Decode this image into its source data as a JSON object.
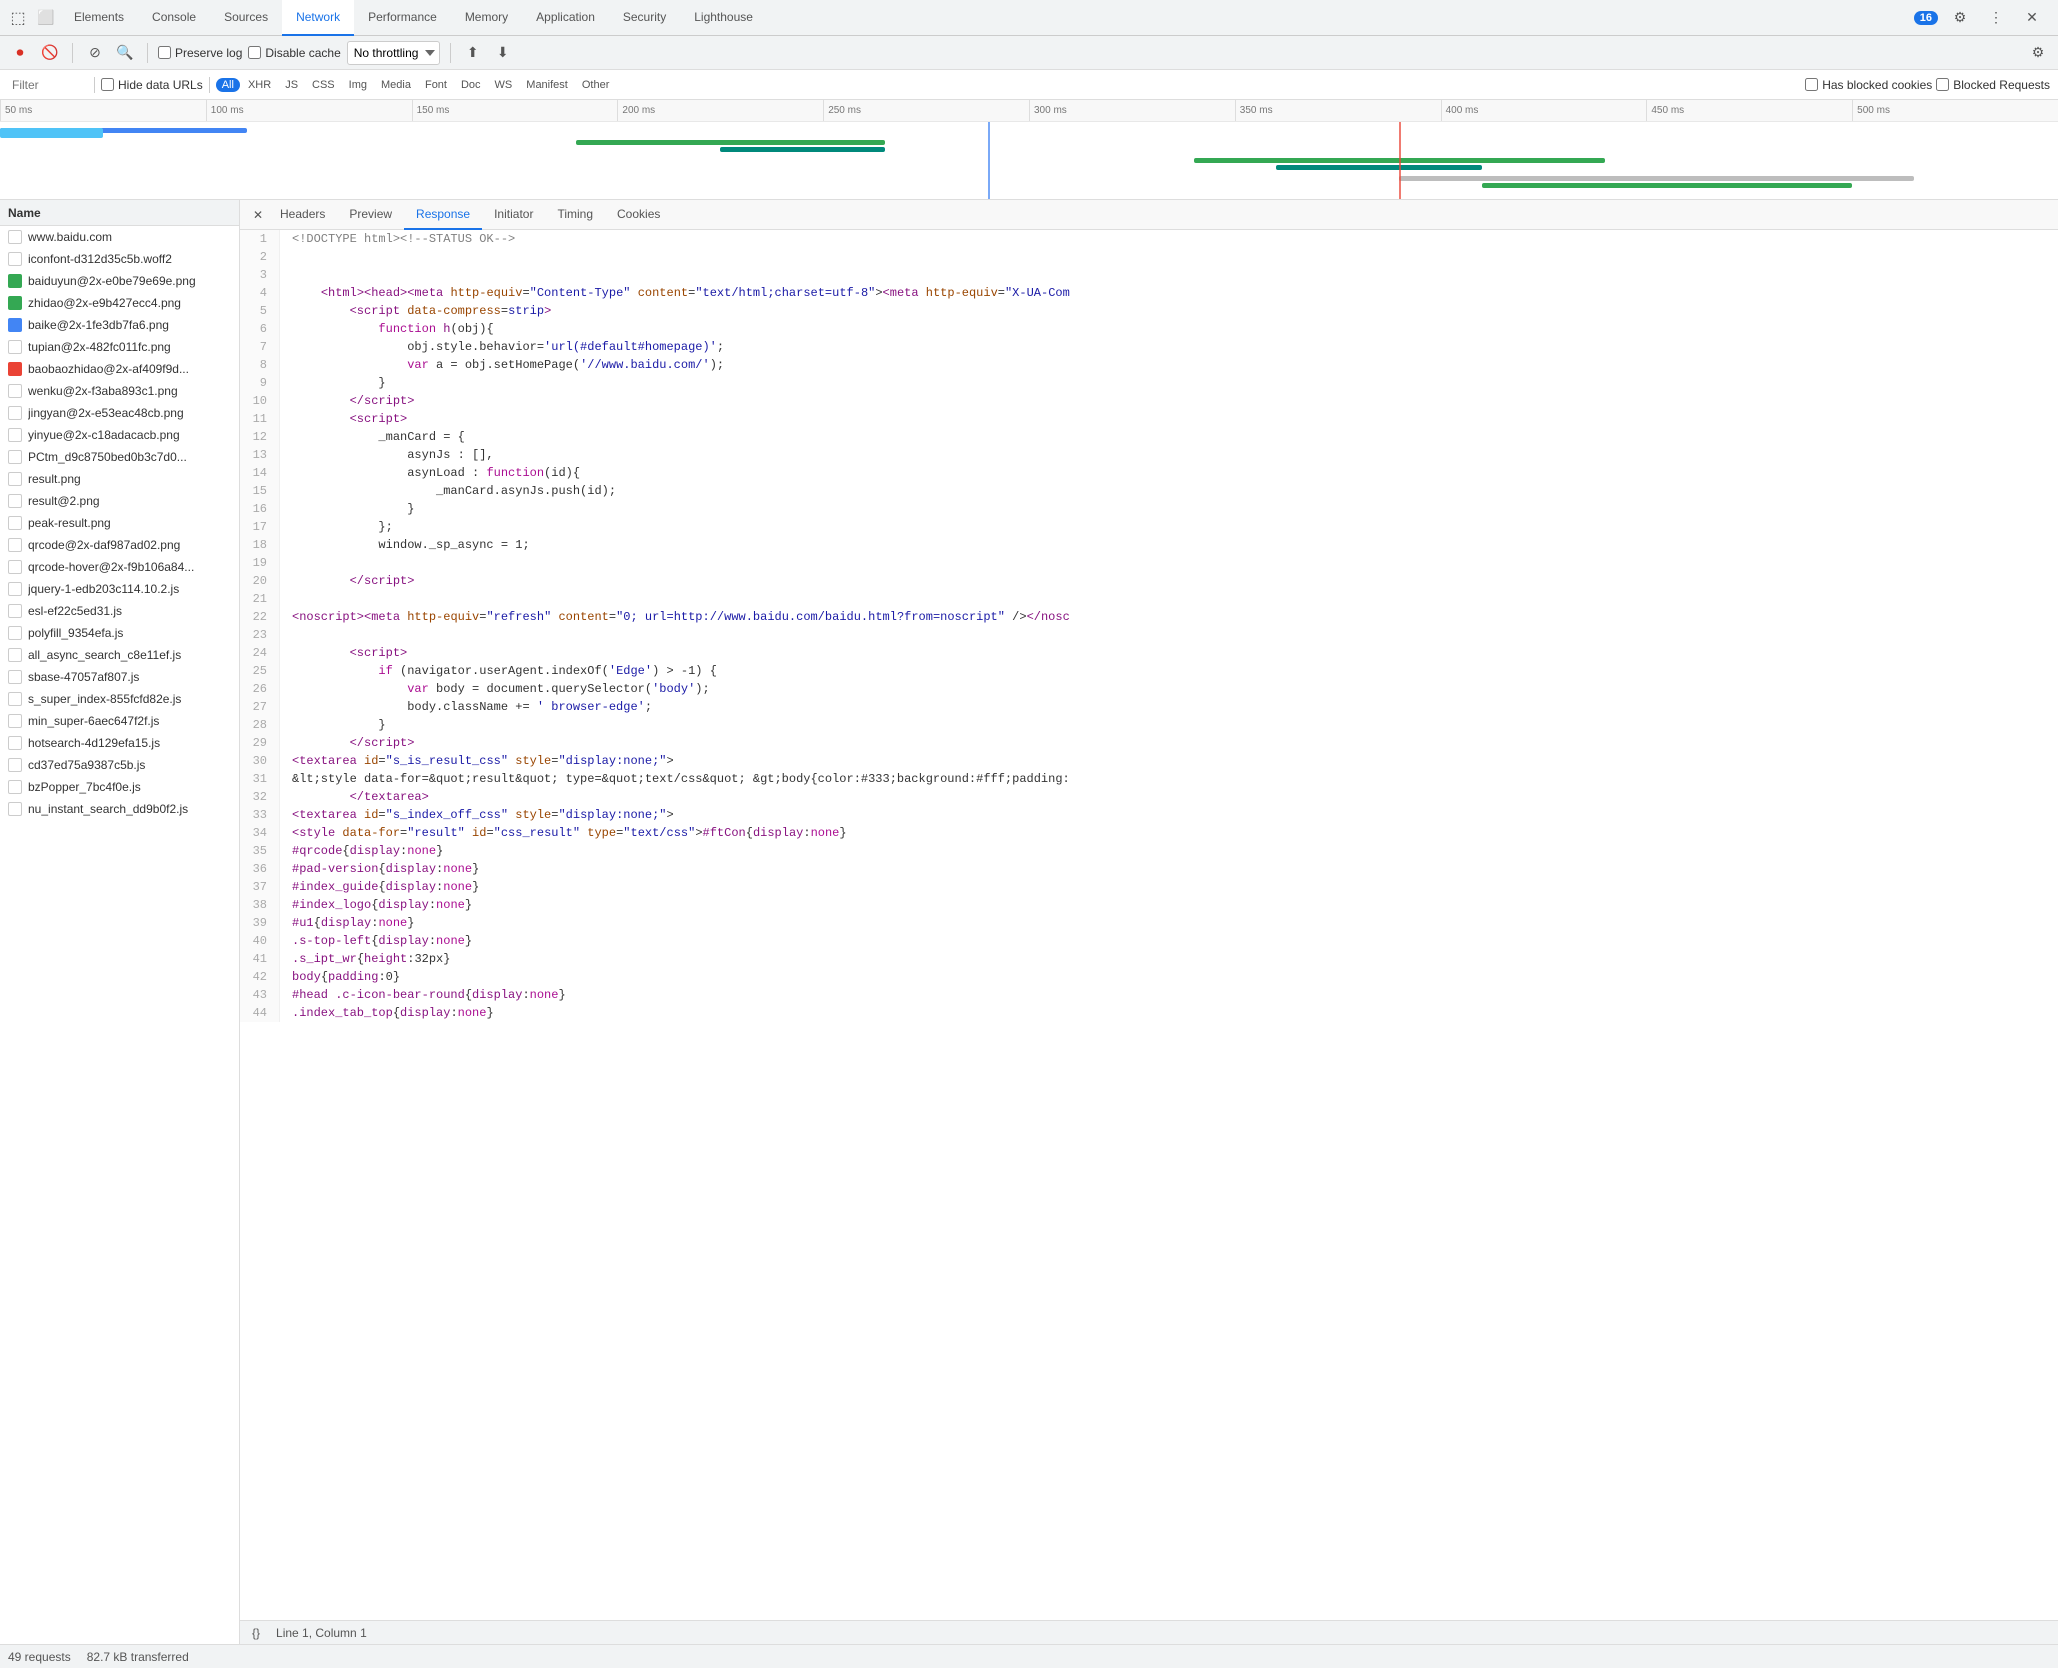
{
  "tabs": [
    {
      "label": "Elements",
      "active": false
    },
    {
      "label": "Console",
      "active": false
    },
    {
      "label": "Sources",
      "active": false
    },
    {
      "label": "Network",
      "active": true
    },
    {
      "label": "Performance",
      "active": false
    },
    {
      "label": "Memory",
      "active": false
    },
    {
      "label": "Application",
      "active": false
    },
    {
      "label": "Security",
      "active": false
    },
    {
      "label": "Lighthouse",
      "active": false
    }
  ],
  "badge": "16",
  "toolbar": {
    "throttle_label": "No throttling",
    "preserve_log": "Preserve log",
    "disable_cache": "Disable cache"
  },
  "filter": {
    "placeholder": "Filter",
    "hide_data_urls": "Hide data URLs",
    "chips": [
      "All",
      "XHR",
      "JS",
      "CSS",
      "Img",
      "Media",
      "Font",
      "Doc",
      "WS",
      "Manifest",
      "Other"
    ],
    "active_chip": "All",
    "has_blocked_cookies": "Has blocked cookies",
    "blocked_requests": "Blocked Requests"
  },
  "ruler": {
    "marks": [
      "50 ms",
      "100 ms",
      "150 ms",
      "200 ms",
      "250 ms",
      "300 ms",
      "350 ms",
      "400 ms",
      "450 ms",
      "500 ms"
    ]
  },
  "sub_tabs": {
    "close": "×",
    "items": [
      "Headers",
      "Preview",
      "Response",
      "Initiator",
      "Timing",
      "Cookies"
    ],
    "active": "Response"
  },
  "files": [
    {
      "name": "www.baidu.com",
      "color": "white",
      "selected": false
    },
    {
      "name": "iconfont-d312d35c5b.woff2",
      "color": "white",
      "selected": false
    },
    {
      "name": "baiduyun@2x-e0be79e69e.png",
      "color": "green",
      "selected": false
    },
    {
      "name": "zhidao@2x-e9b427ecc4.png",
      "color": "green",
      "selected": false
    },
    {
      "name": "baike@2x-1fe3db7fa6.png",
      "color": "blue",
      "selected": false
    },
    {
      "name": "tupian@2x-482fc011fc.png",
      "color": "white",
      "selected": false
    },
    {
      "name": "baobaozhidao@2x-af409f9d...",
      "color": "red",
      "selected": false
    },
    {
      "name": "wenku@2x-f3aba893c1.png",
      "color": "white",
      "selected": false
    },
    {
      "name": "jingyan@2x-e53eac48cb.png",
      "color": "white",
      "selected": false
    },
    {
      "name": "yinyue@2x-c18adacacb.png",
      "color": "white",
      "selected": false
    },
    {
      "name": "PCtm_d9c8750bed0b3c7d0...",
      "color": "white",
      "selected": false
    },
    {
      "name": "result.png",
      "color": "white",
      "selected": false
    },
    {
      "name": "result@2.png",
      "color": "white",
      "selected": false
    },
    {
      "name": "peak-result.png",
      "color": "white",
      "selected": false
    },
    {
      "name": "qrcode@2x-daf987ad02.png",
      "color": "white",
      "selected": false
    },
    {
      "name": "qrcode-hover@2x-f9b106a84...",
      "color": "white",
      "selected": false
    },
    {
      "name": "jquery-1-edb203c114.10.2.js",
      "color": "white",
      "selected": false
    },
    {
      "name": "esl-ef22c5ed31.js",
      "color": "white",
      "selected": false
    },
    {
      "name": "polyfill_9354efa.js",
      "color": "white",
      "selected": false
    },
    {
      "name": "all_async_search_c8e11ef.js",
      "color": "white",
      "selected": false
    },
    {
      "name": "sbase-47057af807.js",
      "color": "white",
      "selected": false
    },
    {
      "name": "s_super_index-855fcfd82e.js",
      "color": "white",
      "selected": false
    },
    {
      "name": "min_super-6aec647f2f.js",
      "color": "white",
      "selected": false
    },
    {
      "name": "hotsearch-4d129efa15.js",
      "color": "white",
      "selected": false
    },
    {
      "name": "cd37ed75a9387c5b.js",
      "color": "white",
      "selected": false
    },
    {
      "name": "bzPopper_7bc4f0e.js",
      "color": "white",
      "selected": false
    },
    {
      "name": "nu_instant_search_dd9b0f2.js",
      "color": "white",
      "selected": false
    }
  ],
  "status_bar": {
    "requests": "49 requests",
    "transferred": "82.7 kB transferred",
    "line_col": "Line 1, Column 1"
  },
  "code_lines": [
    {
      "n": 1,
      "html": "<span class='c-comment'>&lt;!DOCTYPE html&gt;&lt;!--STATUS OK--&gt;</span>"
    },
    {
      "n": 2,
      "html": ""
    },
    {
      "n": 3,
      "html": ""
    },
    {
      "n": 4,
      "html": "    <span class='c-tag'>&lt;html&gt;&lt;head&gt;&lt;meta</span> <span class='c-attr'>http-equiv</span>=<span class='c-val'>\"Content-Type\"</span> <span class='c-attr'>content</span>=<span class='c-val'>\"text/html;charset=utf-8\"</span>&gt;<span class='c-tag'>&lt;meta</span> <span class='c-attr'>http-equiv</span>=<span class='c-val'>\"X-UA-Com</span>"
    },
    {
      "n": 5,
      "html": "        <span class='c-tag'>&lt;script</span> <span class='c-attr'>data-compress</span>=<span class='c-val'>strip</span><span class='c-tag'>&gt;</span>"
    },
    {
      "n": 6,
      "html": "            <span class='c-keyword'>function</span> <span class='c-prop'>h</span>(obj){"
    },
    {
      "n": 7,
      "html": "                obj.style.behavior=<span class='c-string'>'url(#default#homepage)'</span>;"
    },
    {
      "n": 8,
      "html": "                <span class='c-keyword'>var</span> a = obj.setHomePage(<span class='c-string'>'//www.baidu.com/'</span>);"
    },
    {
      "n": 9,
      "html": "            }"
    },
    {
      "n": 10,
      "html": "        <span class='c-tag'>&lt;/script&gt;</span>"
    },
    {
      "n": 11,
      "html": "        <span class='c-tag'>&lt;script&gt;</span>"
    },
    {
      "n": 12,
      "html": "            _manCard = {"
    },
    {
      "n": 13,
      "html": "                asynJs : [],"
    },
    {
      "n": 14,
      "html": "                asynLoad : <span class='c-keyword'>function</span>(id){"
    },
    {
      "n": 15,
      "html": "                    _manCard.asynJs.push(id);"
    },
    {
      "n": 16,
      "html": "                }"
    },
    {
      "n": 17,
      "html": "            };"
    },
    {
      "n": 18,
      "html": "            window._sp_async = 1;"
    },
    {
      "n": 19,
      "html": ""
    },
    {
      "n": 20,
      "html": "        <span class='c-tag'>&lt;/script&gt;</span>"
    },
    {
      "n": 21,
      "html": ""
    },
    {
      "n": 22,
      "html": "<span class='c-tag'>&lt;noscript&gt;</span><span class='c-tag'>&lt;meta</span> <span class='c-attr'>http-equiv</span>=<span class='c-val'>\"refresh\"</span> <span class='c-attr'>content</span>=<span class='c-val'>\"0; url=http://www.baidu.com/baidu.html?from=noscript\"</span> /&gt;<span class='c-tag'>&lt;/nosc</span>"
    },
    {
      "n": 23,
      "html": ""
    },
    {
      "n": 24,
      "html": "        <span class='c-tag'>&lt;script&gt;</span>"
    },
    {
      "n": 25,
      "html": "            <span class='c-keyword'>if</span> (navigator.userAgent.indexOf(<span class='c-string'>'Edge'</span>) &gt; -1) {"
    },
    {
      "n": 26,
      "html": "                <span class='c-keyword'>var</span> body = document.querySelector(<span class='c-string'>'body'</span>);"
    },
    {
      "n": 27,
      "html": "                body.className += <span class='c-string'>' browser-edge'</span>;"
    },
    {
      "n": 28,
      "html": "            }"
    },
    {
      "n": 29,
      "html": "        <span class='c-tag'>&lt;/script&gt;</span>"
    },
    {
      "n": 30,
      "html": "<span class='c-tag'>&lt;textarea</span> <span class='c-attr'>id</span>=<span class='c-val'>\"s_is_result_css\"</span> <span class='c-attr'>style</span>=<span class='c-val'>\"display:none;\"</span>&gt;"
    },
    {
      "n": 31,
      "html": "&amp;lt;style data-for=&amp;quot;result&amp;quot; type=&amp;quot;text/css&amp;quot; &amp;gt;body{color:#333;background:#fff;padding:"
    },
    {
      "n": 32,
      "html": "        <span class='c-tag'>&lt;/textarea&gt;</span>"
    },
    {
      "n": 33,
      "html": "<span class='c-tag'>&lt;textarea</span> <span class='c-attr'>id</span>=<span class='c-val'>\"s_index_off_css\"</span> <span class='c-attr'>style</span>=<span class='c-val'>\"display:none;\"</span>&gt;"
    },
    {
      "n": 34,
      "html": "<span class='c-tag'>&lt;style</span> <span class='c-attr'>data-for</span>=<span class='c-val'>\"result\"</span> <span class='c-attr'>id</span>=<span class='c-val'>\"css_result\"</span> <span class='c-attr'>type</span>=<span class='c-val'>\"text/css\"</span>&gt;<span class='c-selector'>#ftCon</span>{<span class='c-prop'>display</span>:<span class='c-keyword'>none</span>}"
    },
    {
      "n": 35,
      "html": "<span class='c-selector'>#qrcode</span>{<span class='c-prop'>display</span>:<span class='c-keyword'>none</span>}"
    },
    {
      "n": 36,
      "html": "<span class='c-selector'>#pad-version</span>{<span class='c-prop'>display</span>:<span class='c-keyword'>none</span>}"
    },
    {
      "n": 37,
      "html": "<span class='c-selector'>#index_guide</span>{<span class='c-prop'>display</span>:<span class='c-keyword'>none</span>}"
    },
    {
      "n": 38,
      "html": "<span class='c-selector'>#index_logo</span>{<span class='c-prop'>display</span>:<span class='c-keyword'>none</span>}"
    },
    {
      "n": 39,
      "html": "<span class='c-selector'>#u1</span>{<span class='c-prop'>display</span>:<span class='c-keyword'>none</span>}"
    },
    {
      "n": 40,
      "html": "<span class='c-selector'>.s-top-left</span>{<span class='c-prop'>display</span>:<span class='c-keyword'>none</span>}"
    },
    {
      "n": 41,
      "html": "<span class='c-selector'>.s_ipt_wr</span>{<span class='c-prop'>height</span>:<span class='c-num'>32px</span>}"
    },
    {
      "n": 42,
      "html": "<span class='c-selector'>body</span>{<span class='c-prop'>padding</span>:<span class='c-num'>0</span>}"
    },
    {
      "n": 43,
      "html": "<span class='c-selector'>#head .c-icon-bear-round</span>{<span class='c-prop'>display</span>:<span class='c-keyword'>none</span>}"
    },
    {
      "n": 44,
      "html": "<span class='c-selector'>.index_tab_top</span>{<span class='c-prop'>display</span>:<span class='c-keyword'>none</span>}"
    }
  ]
}
